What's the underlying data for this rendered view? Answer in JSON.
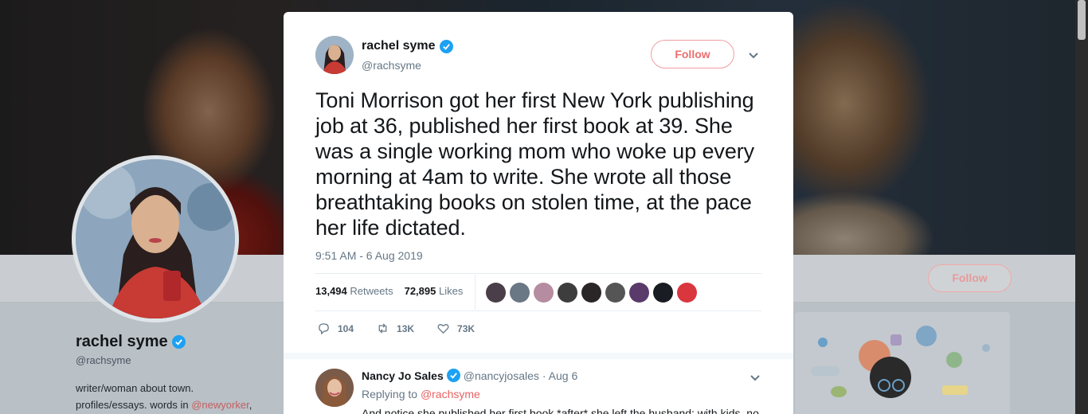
{
  "background_profile": {
    "name": "rachel syme",
    "handle": "@rachsyme",
    "bio_line1": "writer/woman about town.",
    "bio_line2_prefix": "profiles/essays. words in ",
    "bio_link": "@newyorker",
    "bio_line2_suffix": ",",
    "follow_label": "Follow"
  },
  "tweet": {
    "author_name": "rachel syme",
    "author_handle": "@rachsyme",
    "follow_label": "Follow",
    "text": "Toni Morrison got her first New York publishing job at 36, published her first book at 39. She was a single working mom who woke up every morning at 4am to write. She wrote all those breathtaking books on stolen time, at the pace her life dictated.",
    "timestamp": "9:51 AM - 6 Aug 2019",
    "retweets_count": "13,494",
    "retweets_label": "Retweets",
    "likes_count": "72,895",
    "likes_label": "Likes",
    "liker_colors": [
      "#4a3f48",
      "#6a7784",
      "#b58ca0",
      "#3d3d3d",
      "#2a2628",
      "#555555",
      "#5a3a6a",
      "#1a1c24",
      "#d9363e"
    ],
    "reply_count": "104",
    "retweet_count_short": "13K",
    "like_count_short": "73K"
  },
  "reply": {
    "author_name": "Nancy Jo Sales",
    "author_handle": "@nancyjosales",
    "date": "· Aug 6",
    "replying_prefix": "Replying to ",
    "replying_to": "@rachsyme",
    "text": "And notice she published her first book *after* she left the husband; with kids, no"
  },
  "colors": {
    "accent": "#1da1f2",
    "follow": "#e0245e"
  }
}
